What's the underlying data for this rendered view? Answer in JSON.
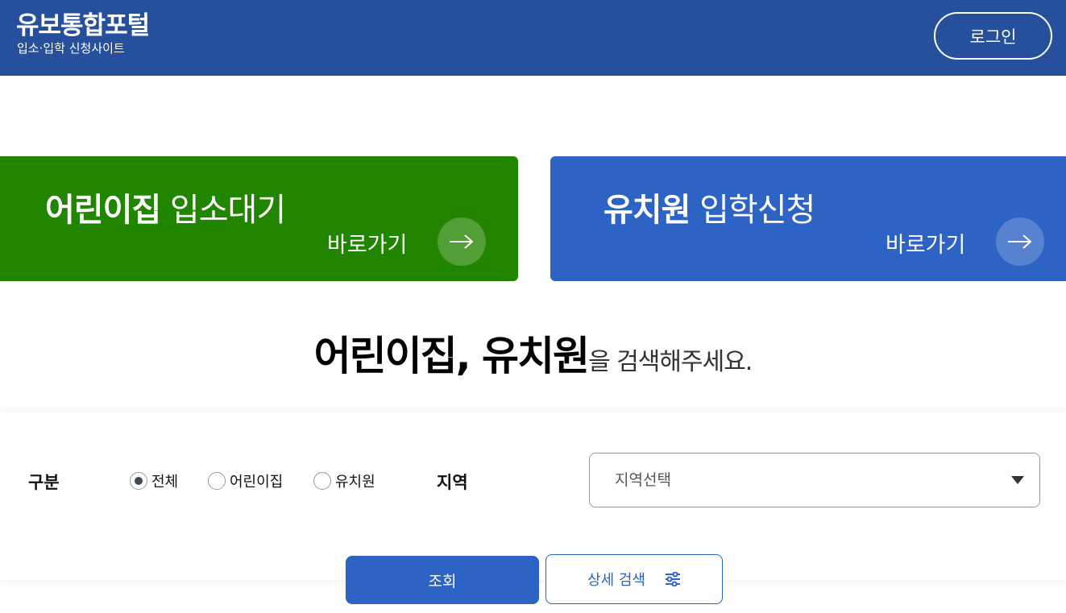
{
  "header": {
    "title": "유보통합포털",
    "subtitle": "입소·입학 신청사이트",
    "login_label": "로그인"
  },
  "cards": [
    {
      "title_strong": "어린이집",
      "title_light": "입소대기",
      "go_label": "바로가기",
      "color": "#228500"
    },
    {
      "title_strong": "유치원",
      "title_light": "입학신청",
      "go_label": "바로가기",
      "color": "#2c63c5"
    }
  ],
  "headline": {
    "strong": "어린이집, 유치원",
    "light": "을 검색해주세요."
  },
  "search": {
    "category_label": "구분",
    "options": [
      {
        "label": "전체",
        "selected": true
      },
      {
        "label": "어린이집",
        "selected": false
      },
      {
        "label": "유치원",
        "selected": false
      }
    ],
    "region_label": "지역",
    "region_placeholder": "지역선택",
    "search_button": "조회",
    "detail_button": "상세 검색"
  },
  "colors": {
    "header_bg": "#26509c",
    "primary": "#2c63c5",
    "green": "#228500"
  },
  "icons": [
    "arrow-right-icon",
    "caret-down-icon",
    "sliders-icon"
  ]
}
